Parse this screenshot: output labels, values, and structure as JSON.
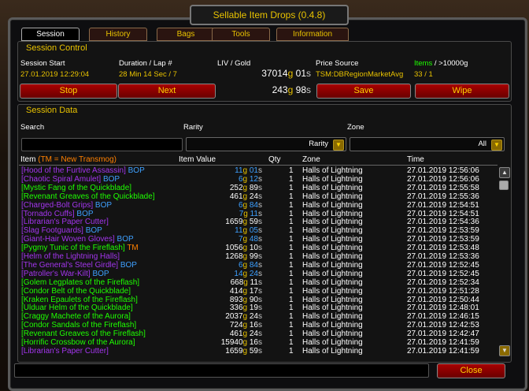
{
  "window": {
    "title": "Sellable Item Drops (0.4.8)"
  },
  "tabs": [
    "Session",
    "History",
    "Bags",
    "Tools",
    "Information"
  ],
  "session_control": {
    "title": "Session Control",
    "start_label": "Session Start",
    "start_value": "27.01.2019 12:29:04",
    "duration_label": "Duration / Lap #",
    "duration_value": "28 Min 14 Sec / 7",
    "liv_label": "LIV / Gold",
    "liv_total_g": "37014",
    "liv_total_s": "01",
    "gold_total_g": "243",
    "gold_total_s": "98",
    "price_label": "Price Source",
    "price_value": "TSM:DBRegionMarketAvg",
    "items_label": "Items",
    "items_suffix": " / >10000g",
    "items_value": "33 / 1",
    "stop": "Stop",
    "next": "Next",
    "save": "Save",
    "wipe": "Wipe"
  },
  "session_data": {
    "title": "Session Data",
    "search_label": "Search",
    "rarity_label": "Rarity",
    "rarity_value": "Rarity",
    "zone_label": "Zone",
    "zone_value": "All",
    "col_item": "Item",
    "col_item_note": "(TM = New Transmog)",
    "col_value": "Item Value",
    "col_qty": "Qty",
    "col_zone": "Zone",
    "col_time": "Time"
  },
  "rows": [
    {
      "name": "[Hood of the Furtive Assassin]",
      "color": "#a335ee",
      "tag": "BOP",
      "tag_color": "#3ea0ff",
      "g": "11",
      "s": "01",
      "gc": "#3ea0ff",
      "qty": "1",
      "zone": "Halls of Lightning",
      "time": "27.01.2019 12:56:06"
    },
    {
      "name": "[Chaotic Spiral Amulet]",
      "color": "#a335ee",
      "tag": "BOP",
      "tag_color": "#3ea0ff",
      "g": "6",
      "s": "12",
      "gc": "#3ea0ff",
      "qty": "1",
      "zone": "Halls of Lightning",
      "time": "27.01.2019 12:56:06"
    },
    {
      "name": "[Mystic Fang of the Quickblade]",
      "color": "#1eff00",
      "tag": "",
      "tag_color": "",
      "g": "252",
      "s": "89",
      "gc": "#ffffff",
      "qty": "1",
      "zone": "Halls of Lightning",
      "time": "27.01.2019 12:55:58"
    },
    {
      "name": "[Revenant Greaves of the Quickblade]",
      "color": "#1eff00",
      "tag": "",
      "tag_color": "",
      "g": "461",
      "s": "24",
      "gc": "#ffffff",
      "qty": "1",
      "zone": "Halls of Lightning",
      "time": "27.01.2019 12:55:36"
    },
    {
      "name": "[Charged-Bolt Grips]",
      "color": "#a335ee",
      "tag": "BOP",
      "tag_color": "#3ea0ff",
      "g": "6",
      "s": "84",
      "gc": "#3ea0ff",
      "qty": "1",
      "zone": "Halls of Lightning",
      "time": "27.01.2019 12:54:51"
    },
    {
      "name": "[Tornado Cuffs]",
      "color": "#a335ee",
      "tag": "BOP",
      "tag_color": "#3ea0ff",
      "g": "7",
      "s": "11",
      "gc": "#3ea0ff",
      "qty": "1",
      "zone": "Halls of Lightning",
      "time": "27.01.2019 12:54:51"
    },
    {
      "name": "[Librarian's Paper Cutter]",
      "color": "#a335ee",
      "tag": "",
      "tag_color": "",
      "g": "1659",
      "s": "59",
      "gc": "#ffffff",
      "qty": "1",
      "zone": "Halls of Lightning",
      "time": "27.01.2019 12:54:36"
    },
    {
      "name": "[Slag Footguards]",
      "color": "#a335ee",
      "tag": "BOP",
      "tag_color": "#3ea0ff",
      "g": "11",
      "s": "05",
      "gc": "#3ea0ff",
      "qty": "1",
      "zone": "Halls of Lightning",
      "time": "27.01.2019 12:53:59"
    },
    {
      "name": "[Giant-Hair Woven Gloves]",
      "color": "#a335ee",
      "tag": "BOP",
      "tag_color": "#3ea0ff",
      "g": "7",
      "s": "48",
      "gc": "#3ea0ff",
      "qty": "1",
      "zone": "Halls of Lightning",
      "time": "27.01.2019 12:53:59"
    },
    {
      "name": "[Pygmy Tunic of the Fireflash]",
      "color": "#1eff00",
      "tag": "TM",
      "tag_color": "#ff8000",
      "g": "1056",
      "s": "10",
      "gc": "#ffffff",
      "qty": "1",
      "zone": "Halls of Lightning",
      "time": "27.01.2019 12:53:48"
    },
    {
      "name": "[Helm of the Lightning Halls]",
      "color": "#a335ee",
      "tag": "",
      "tag_color": "",
      "g": "1268",
      "s": "99",
      "gc": "#ffffff",
      "qty": "1",
      "zone": "Halls of Lightning",
      "time": "27.01.2019 12:53:36"
    },
    {
      "name": "[The General's Steel Girdle]",
      "color": "#a335ee",
      "tag": "BOP",
      "tag_color": "#3ea0ff",
      "g": "6",
      "s": "84",
      "gc": "#3ea0ff",
      "qty": "1",
      "zone": "Halls of Lightning",
      "time": "27.01.2019 12:52:45"
    },
    {
      "name": "[Patroller's War-Kilt]",
      "color": "#a335ee",
      "tag": "BOP",
      "tag_color": "#3ea0ff",
      "g": "14",
      "s": "24",
      "gc": "#3ea0ff",
      "qty": "1",
      "zone": "Halls of Lightning",
      "time": "27.01.2019 12:52:45"
    },
    {
      "name": "[Golem Legplates of the Fireflash]",
      "color": "#1eff00",
      "tag": "",
      "tag_color": "",
      "g": "668",
      "s": "11",
      "gc": "#ffffff",
      "qty": "1",
      "zone": "Halls of Lightning",
      "time": "27.01.2019 12:52:34"
    },
    {
      "name": "[Condor Belt of the Quickblade]",
      "color": "#1eff00",
      "tag": "",
      "tag_color": "",
      "g": "414",
      "s": "17",
      "gc": "#ffffff",
      "qty": "1",
      "zone": "Halls of Lightning",
      "time": "27.01.2019 12:51:28"
    },
    {
      "name": "[Kraken Epaulets of the Fireflash]",
      "color": "#1eff00",
      "tag": "",
      "tag_color": "",
      "g": "893",
      "s": "90",
      "gc": "#ffffff",
      "qty": "1",
      "zone": "Halls of Lightning",
      "time": "27.01.2019 12:50:44"
    },
    {
      "name": "[Ulduar Helm of the Quickblade]",
      "color": "#1eff00",
      "tag": "",
      "tag_color": "",
      "g": "336",
      "s": "19",
      "gc": "#ffffff",
      "qty": "1",
      "zone": "Halls of Lightning",
      "time": "27.01.2019 12:48:01"
    },
    {
      "name": "[Craggy Machete of the Aurora]",
      "color": "#1eff00",
      "tag": "",
      "tag_color": "",
      "g": "2037",
      "s": "24",
      "gc": "#ffffff",
      "qty": "1",
      "zone": "Halls of Lightning",
      "time": "27.01.2019 12:46:15"
    },
    {
      "name": "[Condor Sandals of the Fireflash]",
      "color": "#1eff00",
      "tag": "",
      "tag_color": "",
      "g": "724",
      "s": "16",
      "gc": "#ffffff",
      "qty": "1",
      "zone": "Halls of Lightning",
      "time": "27.01.2019 12:42:53"
    },
    {
      "name": "[Revenant Greaves of the Fireflash]",
      "color": "#1eff00",
      "tag": "",
      "tag_color": "",
      "g": "461",
      "s": "24",
      "gc": "#ffffff",
      "qty": "1",
      "zone": "Halls of Lightning",
      "time": "27.01.2019 12:42:47"
    },
    {
      "name": "[Horrific Crossbow of the Aurora]",
      "color": "#1eff00",
      "tag": "",
      "tag_color": "",
      "g": "15940",
      "s": "16",
      "gc": "#ffffff",
      "qty": "1",
      "zone": "Halls of Lightning",
      "time": "27.01.2019 12:41:59"
    },
    {
      "name": "[Librarian's Paper Cutter]",
      "color": "#a335ee",
      "tag": "",
      "tag_color": "",
      "g": "1659",
      "s": "59",
      "gc": "#ffffff",
      "qty": "1",
      "zone": "Halls of Lightning",
      "time": "27.01.2019 12:41:59"
    }
  ],
  "footer": {
    "close": "Close"
  },
  "coin_letters": {
    "g": "g",
    "s": "s"
  },
  "icons": {
    "scroll_up": "chevron-up-icon",
    "scroll_down": "chevron-down-icon",
    "dropdown": "chevron-down-icon"
  }
}
